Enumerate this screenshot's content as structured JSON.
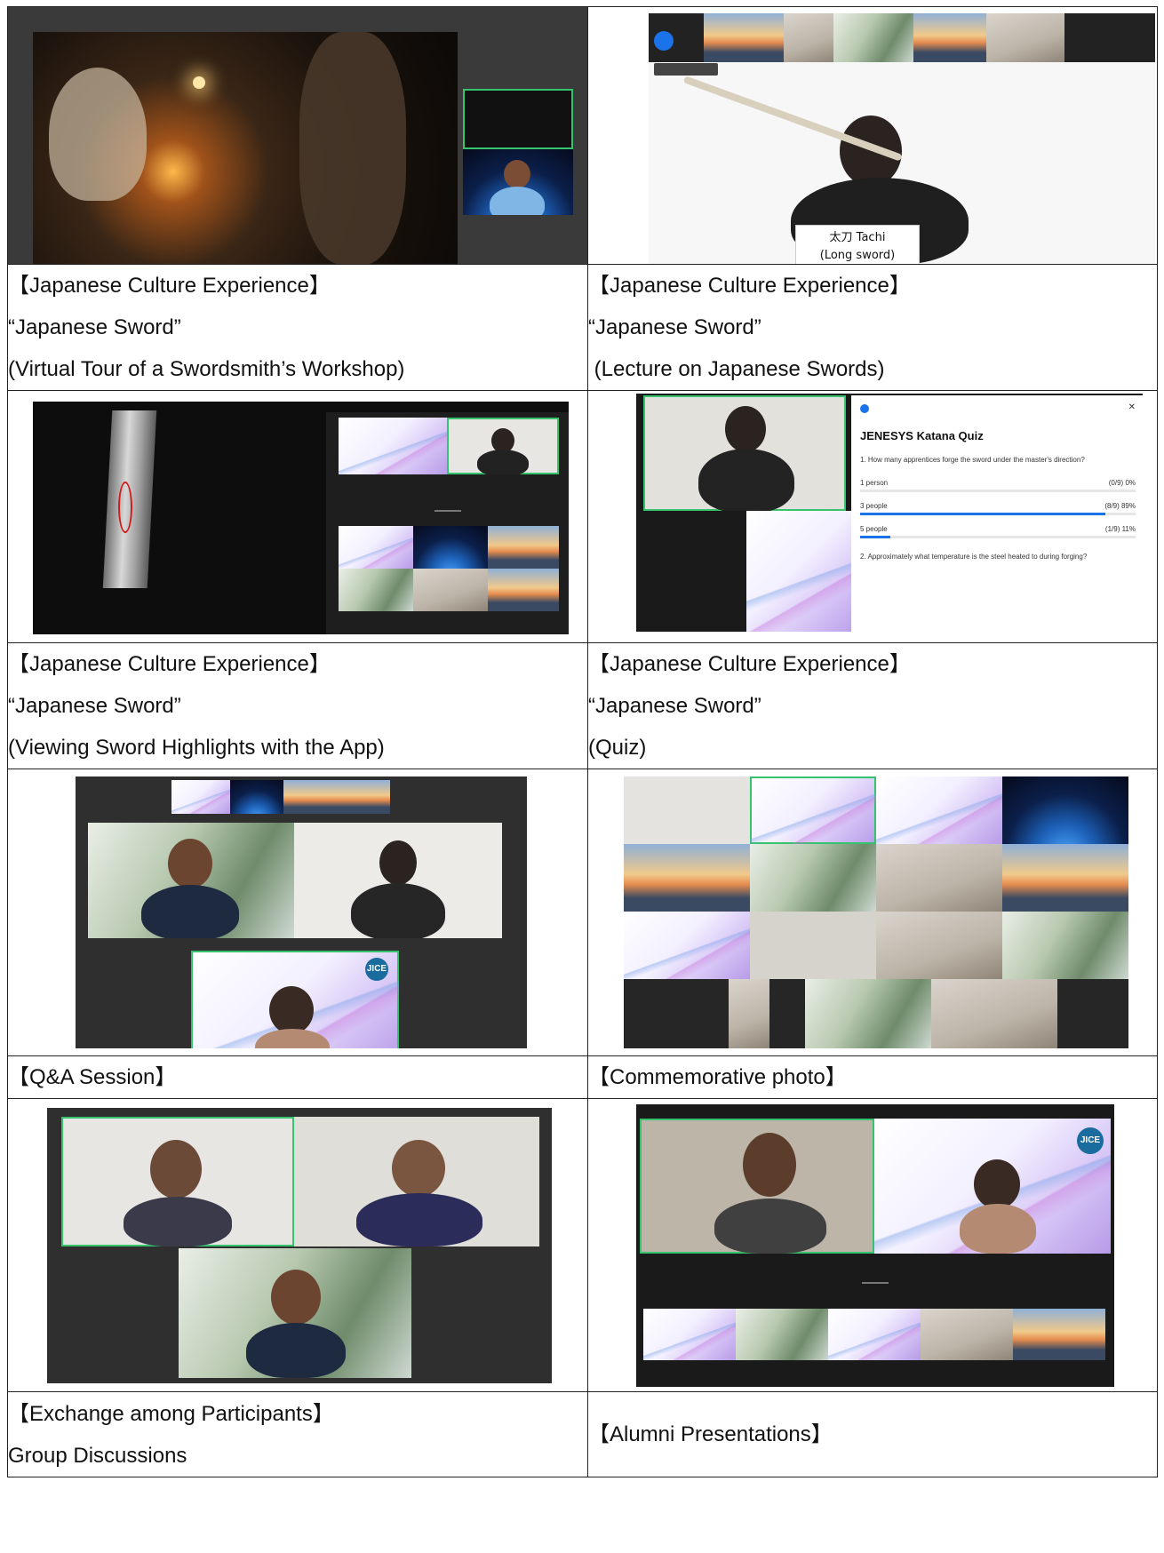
{
  "rows": [
    {
      "left": {
        "caption": [
          "【Japanese Culture Experience】",
          "“Japanese Sword”",
          "(Virtual Tour of a Swordsmith’s Workshop)"
        ]
      },
      "right": {
        "caption": [
          "【Japanese Culture Experience】",
          "“Japanese Sword”",
          " (Lecture on Japanese Swords)"
        ],
        "name_card": [
          "太刀 Tachi",
          "(Long sword)"
        ]
      }
    },
    {
      "left": {
        "caption": [
          "【Japanese Culture Experience】",
          "“Japanese Sword”",
          "(Viewing Sword Highlights with the App)"
        ]
      },
      "right": {
        "caption": [
          "【Japanese Culture Experience】",
          "“Japanese Sword”",
          "(Quiz)"
        ],
        "quiz": {
          "title": "JENESYS Katana Quiz",
          "q1": "1. How many apprentices forge the sword under the master's direction?",
          "options": [
            {
              "label": "1 person",
              "stat": "(0/9) 0%",
              "fill": 0
            },
            {
              "label": "3 people",
              "stat": "(8/9) 89%",
              "fill": 0.89
            },
            {
              "label": "5 people",
              "stat": "(1/9) 11%",
              "fill": 0.11
            }
          ],
          "q2": "2. Approximately what temperature is the steel heated to during forging?"
        }
      }
    },
    {
      "left": {
        "caption": [
          "【Q&A Session】"
        ]
      },
      "right": {
        "caption": [
          "【Commemorative photo】"
        ]
      }
    },
    {
      "left": {
        "caption": [
          "【Exchange among Participants】",
          "Group Discussions"
        ]
      },
      "right": {
        "caption": [
          "【Alumni Presentations】"
        ]
      }
    }
  ],
  "logo_text": "JICE",
  "colors": {
    "border": "#222222",
    "highlight": "#35c46d",
    "quiz_bar": "#1a73e8"
  }
}
